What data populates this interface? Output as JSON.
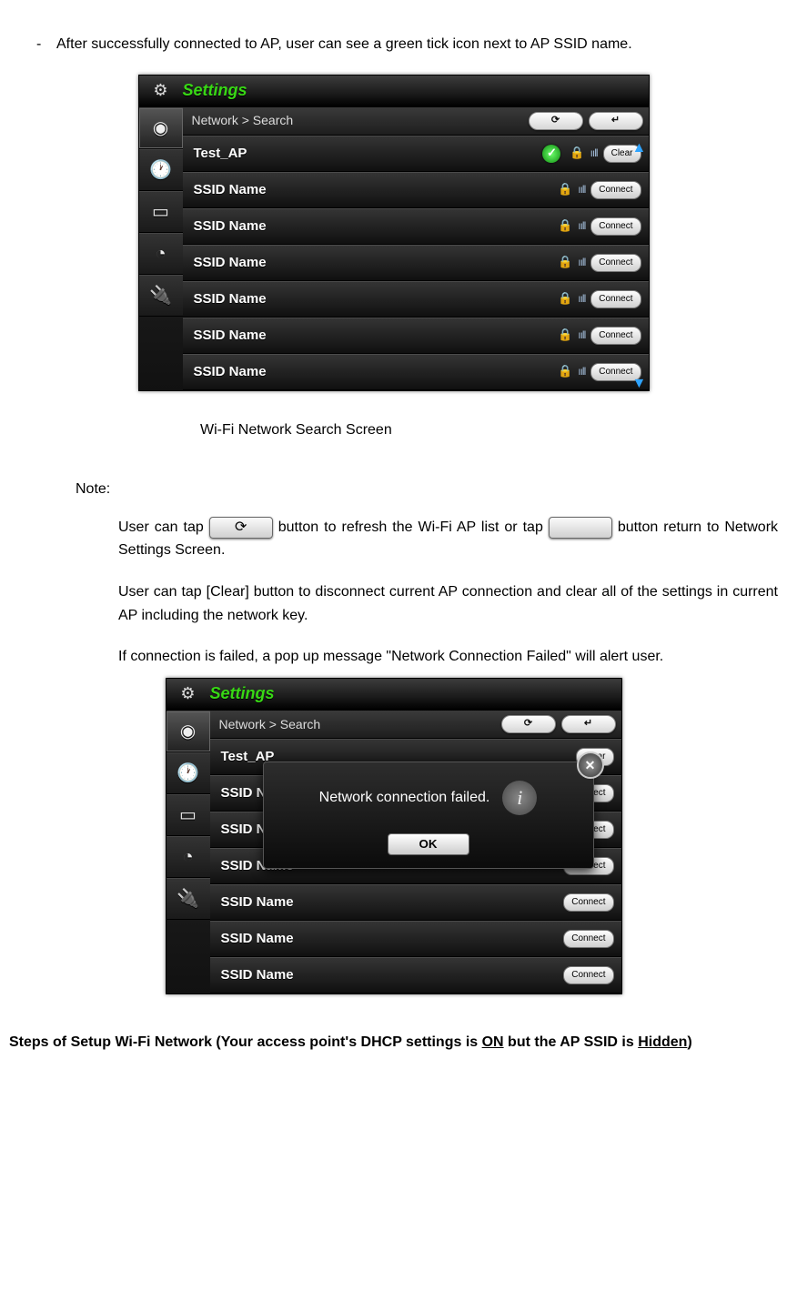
{
  "bullet_text": "After successfully connected to AP, user can see a green tick icon next to AP SSID name.",
  "caption1": "Wi-Fi Network Search Screen",
  "note_label": "Note:",
  "note1_a": "User can tap ",
  "note1_b": " button to refresh the Wi-Fi AP list or tap ",
  "note1_c": " button return     to Network Settings Screen.",
  "note2": "User can tap [Clear] button to disconnect current AP connection and clear all of the settings in current AP including the network key.",
  "note3": "If connection is failed, a pop up message \"Network Connection Failed\" will alert user.",
  "heading_a": "Steps of Setup Wi-Fi Network (Your access point's DHCP settings is ",
  "heading_on": "ON",
  "heading_b": " but the AP SSID is ",
  "heading_hidden": "Hidden",
  "heading_c": ")",
  "device": {
    "title": "Settings",
    "breadcrumb": "Network > Search",
    "refresh_glyph": "⟳",
    "back_glyph": "↵",
    "clear_label": "Clear",
    "connect_label": "Connect",
    "rows": [
      {
        "name": "Test_AP",
        "connected": true,
        "btn": "Clear"
      },
      {
        "name": "SSID Name",
        "connected": false,
        "btn": "Connect"
      },
      {
        "name": "SSID Name",
        "connected": false,
        "btn": "Connect"
      },
      {
        "name": "SSID Name",
        "connected": false,
        "btn": "Connect"
      },
      {
        "name": "SSID Name",
        "connected": false,
        "btn": "Connect"
      },
      {
        "name": "SSID Name",
        "connected": false,
        "btn": "Connect"
      },
      {
        "name": "SSID Name",
        "connected": false,
        "btn": "Connect"
      }
    ],
    "modal": {
      "message": "Network  connection  failed.",
      "ok": "OK"
    }
  }
}
